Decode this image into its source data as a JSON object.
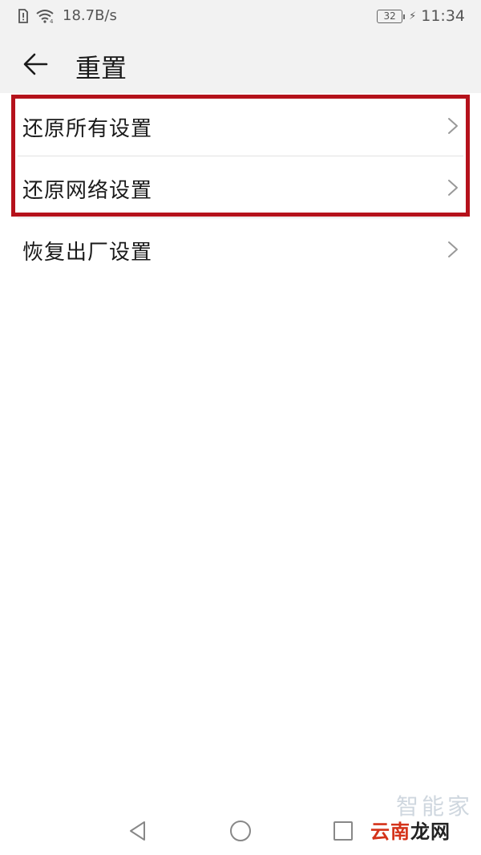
{
  "status_bar": {
    "network_speed": "18.7B/s",
    "battery_level": "32",
    "time": "11:34",
    "icons": [
      "sim-alert-icon",
      "wifi-icon",
      "battery-icon",
      "charging-icon"
    ]
  },
  "header": {
    "title": "重置",
    "back_icon": "back-arrow-icon"
  },
  "list": {
    "items": [
      {
        "label": "还原所有设置"
      },
      {
        "label": "还原网络设置"
      },
      {
        "label": "恢复出厂设置"
      }
    ]
  },
  "highlight_color": "#b5121b",
  "nav": {
    "icons": [
      "back-triangle-icon",
      "home-circle-icon",
      "recent-square-icon"
    ]
  },
  "watermark": {
    "top": "智能家",
    "main_red": "云南",
    "main_black": "龙网"
  }
}
